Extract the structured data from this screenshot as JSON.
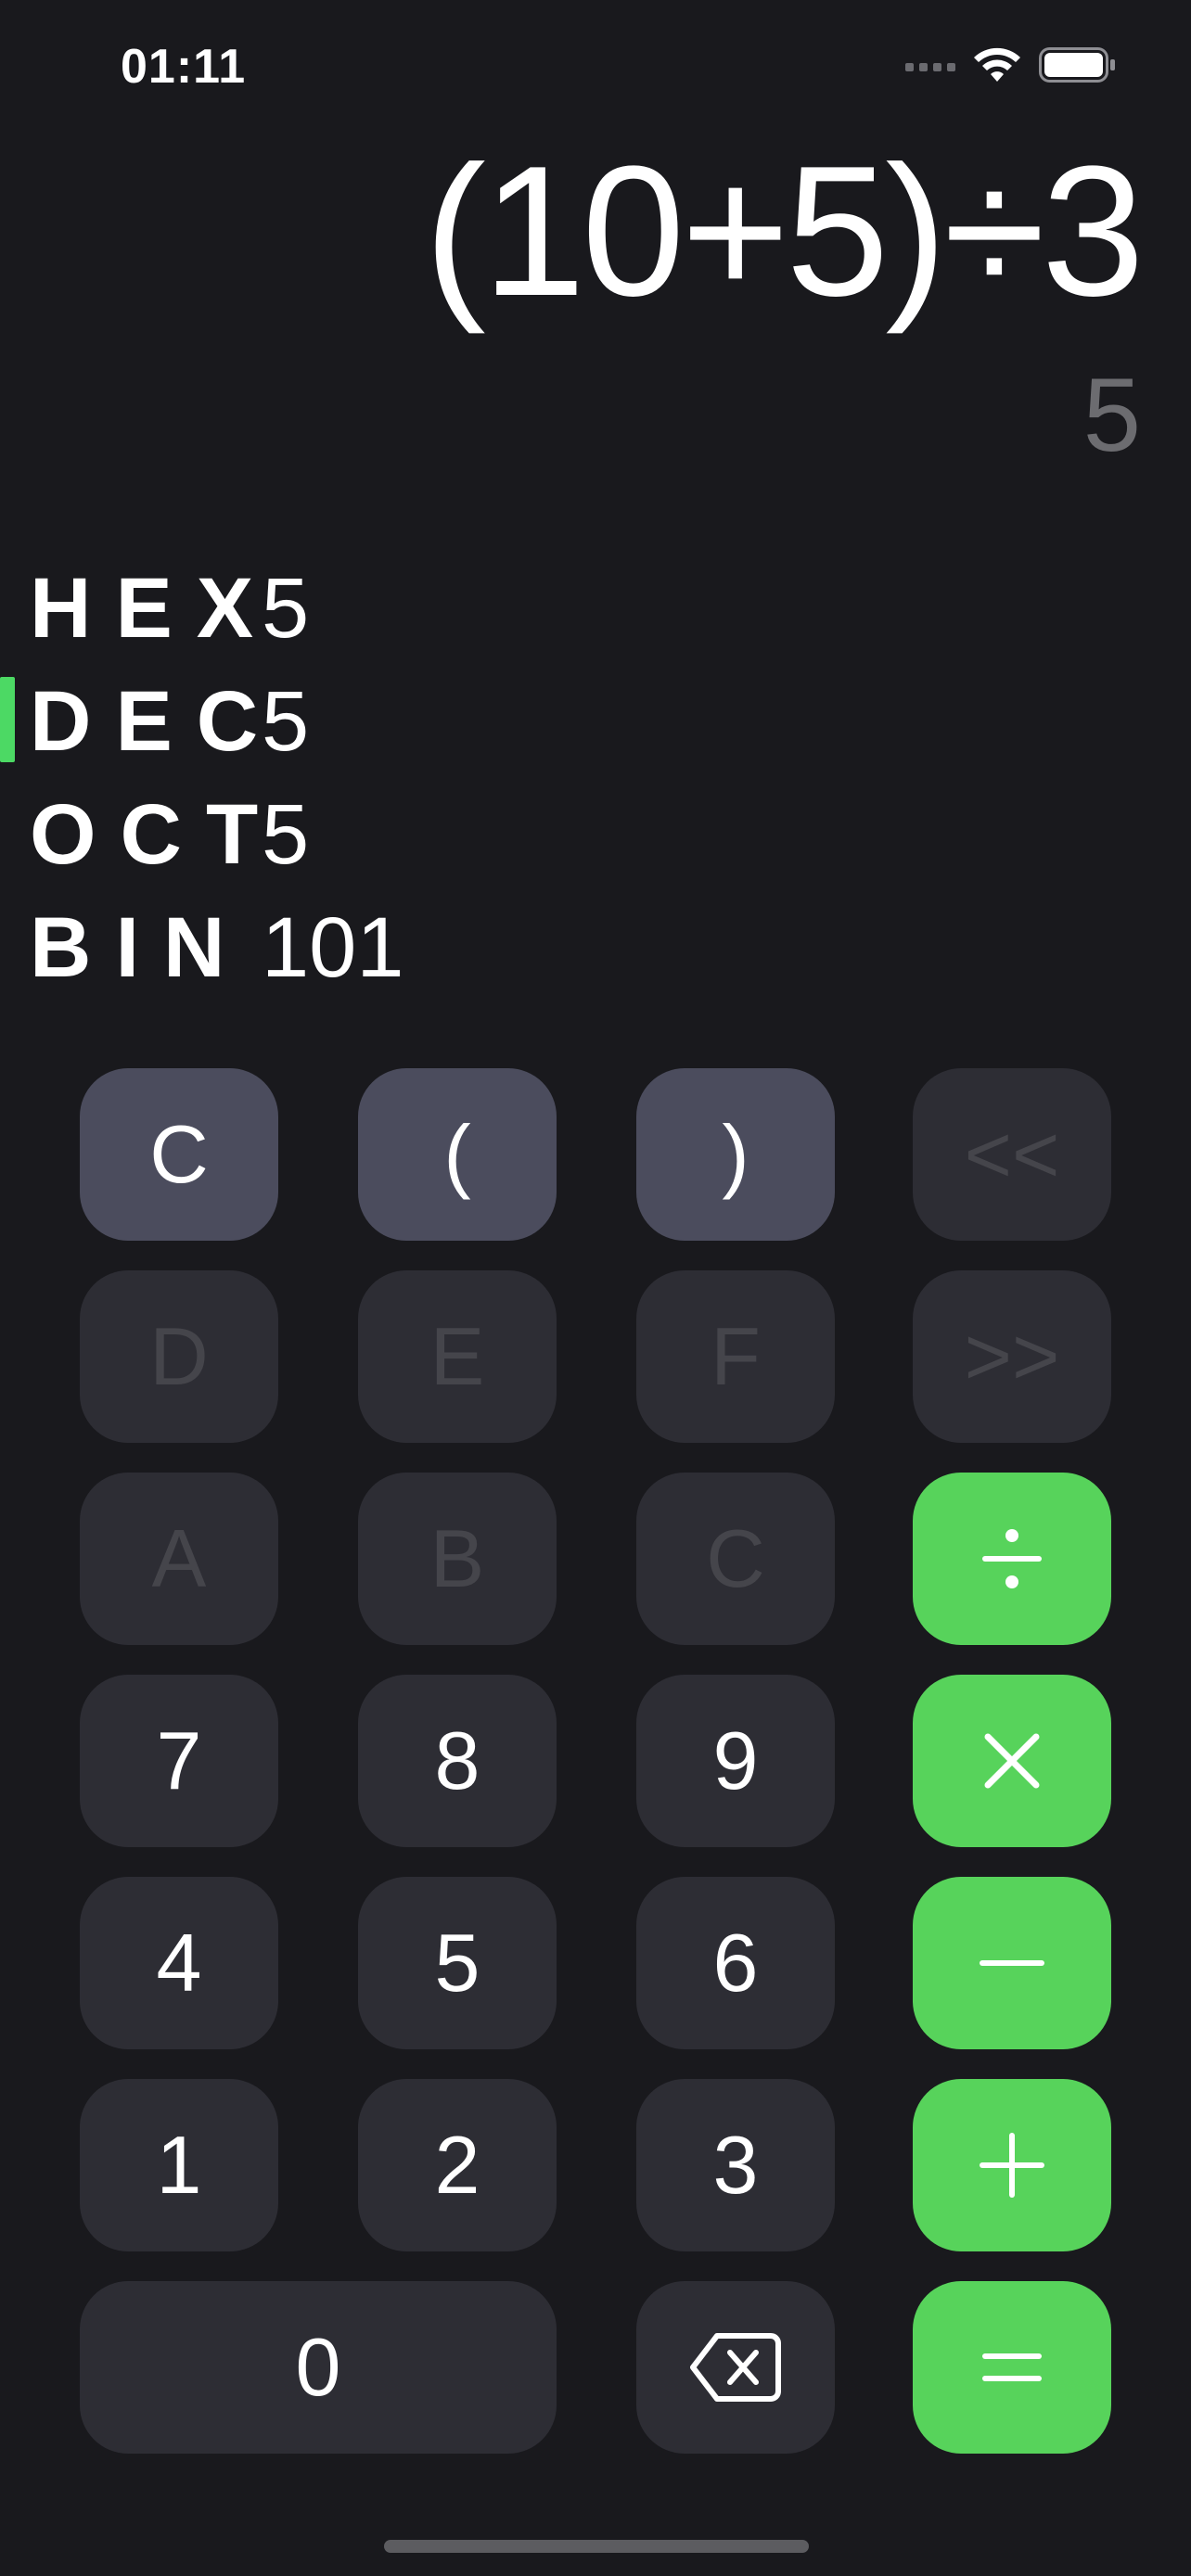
{
  "status_bar": {
    "time": "01:11",
    "icons": [
      "cellular-signal-icon",
      "wifi-icon",
      "battery-icon"
    ]
  },
  "display": {
    "expression": "(10+5)÷3",
    "result": "5"
  },
  "bases": [
    {
      "name": "HEX",
      "value": "5",
      "selected": false
    },
    {
      "name": "DEC",
      "value": "5",
      "selected": true
    },
    {
      "name": "OCT",
      "value": "5",
      "selected": false
    },
    {
      "name": "BIN",
      "value": "101",
      "selected": false
    }
  ],
  "keys": {
    "clear": "C",
    "open_paren": "(",
    "close_paren": ")",
    "shift_left": "<<",
    "hex_d": "D",
    "hex_e": "E",
    "hex_f": "F",
    "shift_right": ">>",
    "hex_a": "A",
    "hex_b": "B",
    "hex_c": "C",
    "seven": "7",
    "eight": "8",
    "nine": "9",
    "four": "4",
    "five": "5",
    "six": "6",
    "one": "1",
    "two": "2",
    "three": "3",
    "zero": "0"
  },
  "operator_icons": [
    "divide-icon",
    "multiply-icon",
    "minus-icon",
    "plus-icon",
    "equals-icon",
    "backspace-icon"
  ],
  "colors": {
    "background": "#19191d",
    "key": "#2d2d34",
    "key_light": "#4b4c5d",
    "operator": "#57d35b",
    "accent": "#4cd964",
    "disabled_text": "#45454b",
    "result_text": "#6c6c70"
  }
}
